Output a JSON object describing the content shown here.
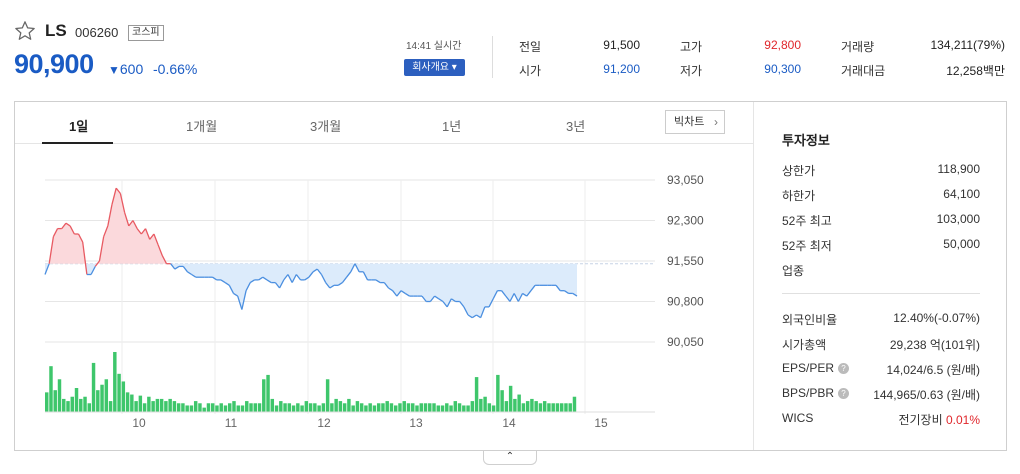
{
  "stock": {
    "name": "LS",
    "code": "006260",
    "market": "코스피",
    "price": "90,900",
    "change_arrow": "▼",
    "change": "600",
    "change_rate": "-0.66%"
  },
  "realtime": {
    "time_label": "14:41 실시간",
    "company_button": "회사개요 ▾"
  },
  "quote": {
    "prev_close": {
      "label": "전일",
      "value": "91,500"
    },
    "open": {
      "label": "시가",
      "value": "91,200"
    },
    "high": {
      "label": "고가",
      "value": "92,800"
    },
    "low": {
      "label": "저가",
      "value": "90,300"
    },
    "volume": {
      "label": "거래량",
      "value": "134,211(79%)"
    },
    "amount": {
      "label": "거래대금",
      "value": "12,258백만"
    }
  },
  "tabs": [
    "1일",
    "1개월",
    "3개월",
    "1년",
    "3년"
  ],
  "bigchart_label": "빅차트",
  "info": {
    "title": "투자정보",
    "rows": [
      {
        "label": "상한가",
        "value": "118,900"
      },
      {
        "label": "하한가",
        "value": "64,100"
      },
      {
        "label": "52주 최고",
        "value": "103,000"
      },
      {
        "label": "52주 최저",
        "value": "50,000"
      },
      {
        "label": "업종",
        "value": ""
      }
    ],
    "rows2": [
      {
        "label": "외국인비율",
        "value": "12.40%(-0.07%)"
      },
      {
        "label": "시가총액",
        "value": "29,238 억(101위)"
      },
      {
        "label": "EPS/PER",
        "value": "14,024/6.5 (원/배)"
      },
      {
        "label": "BPS/PBR",
        "value": "144,965/0.63 (원/배)"
      },
      {
        "label": "WICS",
        "value": "전기장비 0.01%"
      }
    ]
  },
  "colors": {
    "up": "#e0262b",
    "down": "#1a5bc4",
    "line_up": "#e85a62",
    "line_down": "#4b8fe0",
    "fill_up": "#fbd9dc",
    "fill_down": "#dcebfb",
    "volume": "#3ec66b"
  },
  "expand_icon": "chevron-up-icon",
  "chart_data": {
    "type": "line",
    "ylim": [
      90050,
      93050
    ],
    "yticks": [
      "93,050",
      "92,300",
      "91,550",
      "90,800",
      "90,050"
    ],
    "xticks": [
      "10",
      "11",
      "12",
      "13",
      "14",
      "15"
    ],
    "base_price": 91500,
    "price_series": [
      91300,
      91500,
      92000,
      92150,
      92150,
      92250,
      92200,
      92050,
      92050,
      91900,
      91300,
      91300,
      91450,
      91550,
      92000,
      92200,
      92600,
      92900,
      92800,
      92450,
      92200,
      92300,
      92150,
      92050,
      92150,
      91950,
      92050,
      91850,
      91650,
      91500,
      91500,
      91400,
      91450,
      91450,
      91350,
      91300,
      91250,
      91250,
      91250,
      91250,
      91250,
      91200,
      91200,
      91150,
      91100,
      90950,
      90900,
      90650,
      91000,
      91150,
      91200,
      91200,
      91250,
      91200,
      91150,
      91150,
      91050,
      91200,
      91300,
      91150,
      91300,
      91200,
      91200,
      91250,
      91350,
      91400,
      91300,
      91150,
      91050,
      91100,
      91100,
      91150,
      91250,
      91350,
      91500,
      91350,
      91350,
      91200,
      91200,
      91200,
      91150,
      91150,
      91050,
      91000,
      90900,
      91000,
      90950,
      90900,
      90900,
      90900,
      90900,
      90800,
      90800,
      90900,
      90850,
      90800,
      90700,
      90850,
      90800,
      90800,
      90700,
      90550,
      90500,
      90550,
      90500,
      90700,
      90700,
      90850,
      91000,
      91000,
      90900,
      90800,
      90950,
      90800,
      90950,
      90900,
      91000,
      91100,
      91100,
      91100,
      91100,
      91100,
      91100,
      91000,
      91000,
      90950,
      90950,
      90900
    ],
    "volume_series": [
      18,
      42,
      20,
      30,
      12,
      10,
      14,
      22,
      12,
      14,
      8,
      45,
      20,
      25,
      30,
      10,
      55,
      35,
      28,
      18,
      16,
      10,
      15,
      8,
      14,
      10,
      12,
      12,
      10,
      12,
      10,
      8,
      8,
      6,
      6,
      10,
      8,
      4,
      8,
      8,
      6,
      8,
      6,
      8,
      10,
      6,
      6,
      10,
      8,
      8,
      8,
      30,
      34,
      12,
      6,
      10,
      8,
      8,
      6,
      8,
      6,
      10,
      8,
      8,
      6,
      8,
      30,
      8,
      12,
      10,
      8,
      12,
      6,
      10,
      8,
      6,
      8,
      6,
      8,
      8,
      10,
      8,
      6,
      8,
      10,
      8,
      8,
      6,
      8,
      8,
      8,
      8,
      6,
      6,
      8,
      6,
      10,
      8,
      6,
      6,
      10,
      32,
      12,
      14,
      8,
      6,
      34,
      20,
      10,
      24,
      12,
      16,
      8,
      10,
      12,
      10,
      8,
      10,
      8,
      8,
      8,
      8,
      8,
      8,
      14
    ]
  }
}
